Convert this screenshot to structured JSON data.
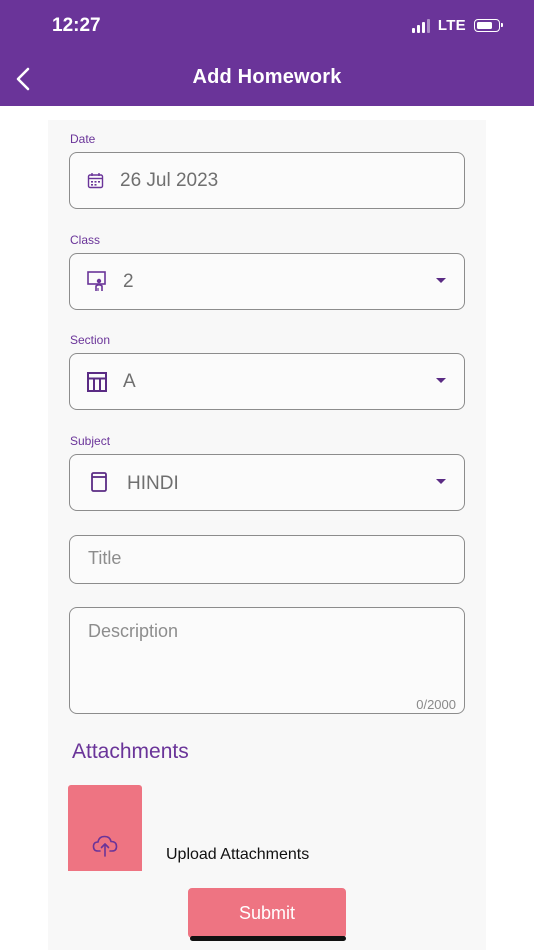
{
  "status_bar": {
    "time": "12:27",
    "network": "LTE"
  },
  "header": {
    "title": "Add Homework",
    "back_icon": "chevron-left-icon"
  },
  "form": {
    "date": {
      "label": "Date",
      "value": "26 Jul 2023",
      "icon": "calendar-icon"
    },
    "class": {
      "label": "Class",
      "value": "2",
      "icon": "classroom-teacher-icon"
    },
    "section": {
      "label": "Section",
      "value": "A",
      "icon": "table-icon"
    },
    "subject": {
      "label": "Subject",
      "value": "HINDI",
      "icon": "book-icon"
    },
    "title": {
      "placeholder": "Title"
    },
    "description": {
      "placeholder": "Description",
      "counter": "0/2000"
    }
  },
  "attachments": {
    "heading": "Attachments",
    "upload_label": "Upload Attachments",
    "upload_icon": "cloud-upload-icon"
  },
  "submit_label": "Submit",
  "colors": {
    "primary": "#6a3499",
    "accent": "#ee7482",
    "background": "#f8f8f8"
  }
}
